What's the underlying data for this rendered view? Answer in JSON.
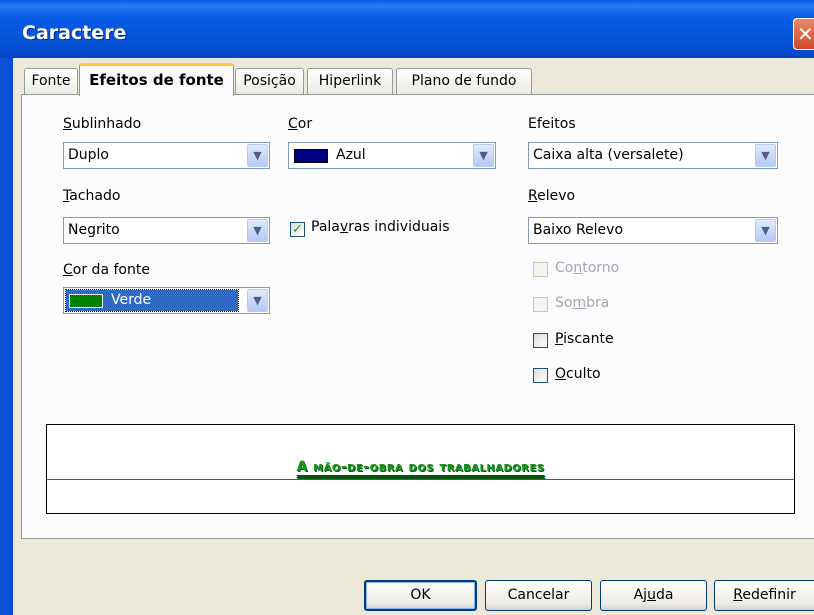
{
  "window": {
    "title": "Caractere",
    "close_glyph": "✕"
  },
  "tabs": [
    {
      "label": "Fonte"
    },
    {
      "label": "Efeitos de fonte"
    },
    {
      "label": "Posição"
    },
    {
      "label": "Hiperlink"
    },
    {
      "label": "Plano de fundo"
    }
  ],
  "underline": {
    "label_pre": "",
    "label_key": "S",
    "label_post": "ublinhado",
    "value": "Duplo"
  },
  "strikethrough": {
    "label_key": "T",
    "label_post": "achado",
    "value": "Negrito"
  },
  "font_color": {
    "label_key": "C",
    "label_post": "or da fonte",
    "value": "Verde",
    "swatch_color": "#008000"
  },
  "color": {
    "label_key": "C",
    "label_post": "or",
    "value": "Azul",
    "swatch_color": "#000080"
  },
  "individual_words": {
    "label_pre": "Pala",
    "label_key": "v",
    "label_post": "ras individuais",
    "checked": true
  },
  "effects": {
    "label": "Efeitos",
    "value": "Caixa alta (versalete)"
  },
  "relief": {
    "label_key": "R",
    "label_post": "elevo",
    "value": "Baixo Relevo"
  },
  "outline": {
    "label_pre": "Co",
    "label_key": "n",
    "label_post": "torno",
    "enabled": false
  },
  "shadow": {
    "label_pre": "So",
    "label_key": "m",
    "label_post": "bra",
    "enabled": false
  },
  "blinking": {
    "label_key": "P",
    "label_post": "iscante",
    "checked": false
  },
  "hidden": {
    "label_key": "O",
    "label_post": "culto",
    "checked": false
  },
  "preview": {
    "text": "A mão-de-obra dos trabalhadores"
  },
  "buttons": {
    "ok": "OK",
    "cancel": "Cancelar",
    "help_pre": "Aj",
    "help_key": "u",
    "help_post": "da",
    "reset_key": "R",
    "reset_post": "edefinir"
  },
  "colors": {
    "check_mark": "#21a121",
    "title_bar": "#0a5ce6",
    "dialog_bg": "#ece9d8"
  },
  "icons": {
    "combo_arrow": "chevron-down-icon",
    "check": "checkmark-icon"
  }
}
